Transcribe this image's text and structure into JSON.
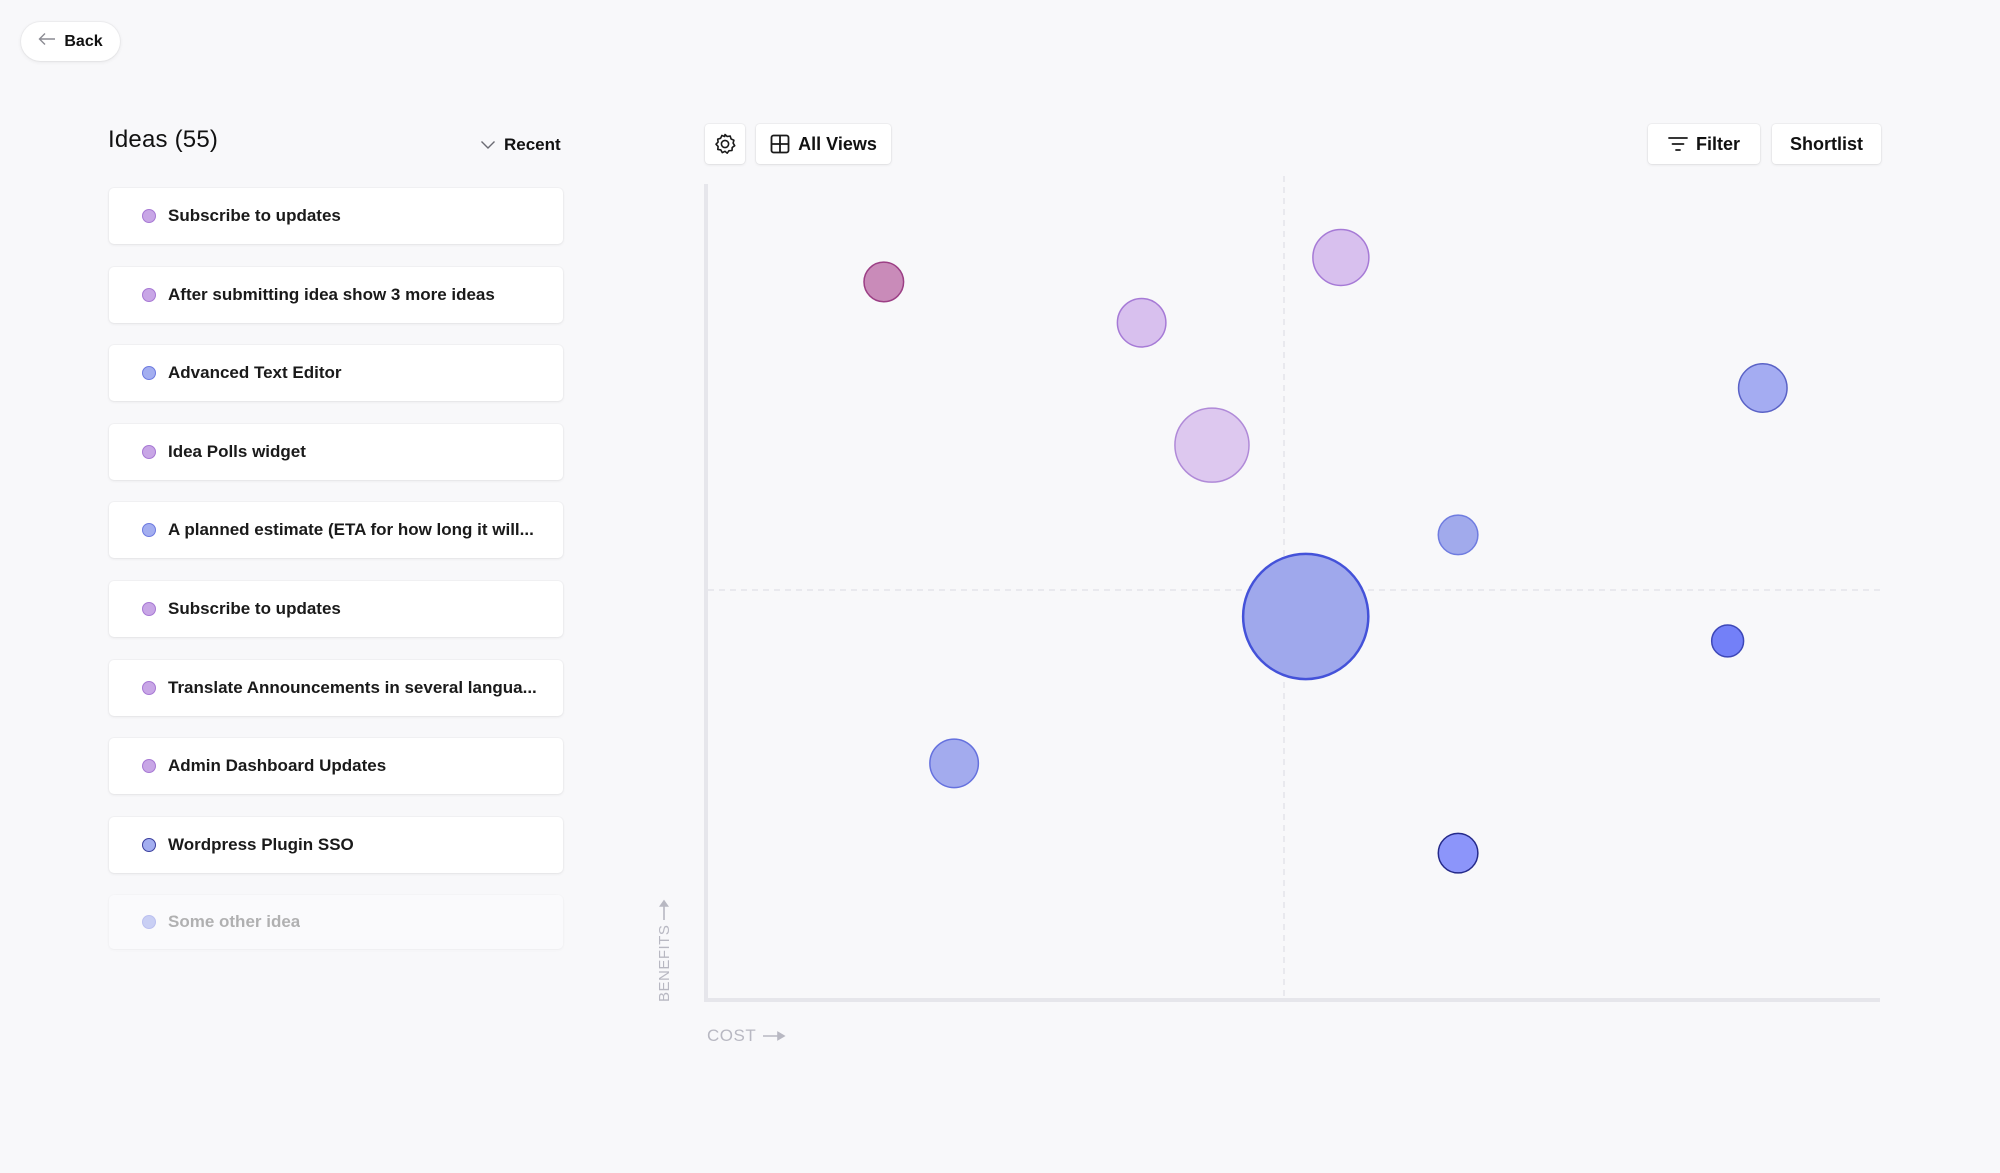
{
  "back_button": {
    "label": "Back",
    "icon": "arrow-left-icon"
  },
  "ideas_panel": {
    "title": "Ideas (55)",
    "sort": {
      "label": "Recent",
      "icon": "chevron-down-icon"
    },
    "items": [
      {
        "label": "Subscribe to updates",
        "dot_fill": "#c8a6e6",
        "dot_border": "#a778d4"
      },
      {
        "label": "After submitting idea show 3 more ideas",
        "dot_fill": "#c8a6e6",
        "dot_border": "#a778d4"
      },
      {
        "label": "Advanced Text Editor",
        "dot_fill": "#a3aef0",
        "dot_border": "#6d7ae0"
      },
      {
        "label": "Idea Polls widget",
        "dot_fill": "#c8a6e6",
        "dot_border": "#a778d4"
      },
      {
        "label": "A planned estimate (ETA for how long it will...",
        "dot_fill": "#a3aef0",
        "dot_border": "#6d7ae0"
      },
      {
        "label": "Subscribe to updates",
        "dot_fill": "#c8a6e6",
        "dot_border": "#a778d4"
      },
      {
        "label": "Translate Announcements in several langua...",
        "dot_fill": "#c8a6e6",
        "dot_border": "#a778d4"
      },
      {
        "label": "Admin Dashboard Updates",
        "dot_fill": "#c8a6e6",
        "dot_border": "#a778d4"
      },
      {
        "label": "Wordpress Plugin SSO",
        "dot_fill": "#a3aef0",
        "dot_border": "#3b3f9e"
      },
      {
        "label": "Some other idea",
        "dot_fill": "#a3aef0",
        "dot_border": "#8a93e8",
        "faded": true
      }
    ]
  },
  "toolbar": {
    "settings_icon": "gear-icon",
    "views": {
      "label": "All Views",
      "icon": "grid-icon"
    },
    "filter": {
      "label": "Filter",
      "icon": "filter-icon"
    },
    "shortlist": {
      "label": "Shortlist"
    }
  },
  "chart_data": {
    "type": "scatter",
    "subtype": "bubble-matrix",
    "xlabel": "COST",
    "ylabel": "BENEFITS",
    "xlim": [
      0,
      100
    ],
    "ylim": [
      0,
      100
    ],
    "quadrant_divider": {
      "x": 50,
      "y": 50
    },
    "grid": false,
    "points": [
      {
        "x": 15,
        "y": 88,
        "size": 2,
        "fill": "#c98bb9",
        "stroke": "#9c3f85"
      },
      {
        "x": 37,
        "y": 83,
        "size": 3,
        "fill": "#d8c0ee",
        "stroke": "#a67ad6"
      },
      {
        "x": 54,
        "y": 91,
        "size": 4,
        "fill": "#d8c0ee",
        "stroke": "#a67ad6"
      },
      {
        "x": 43,
        "y": 68,
        "size": 7,
        "fill": "#ddc8ef",
        "stroke": "#b08ad8"
      },
      {
        "x": 90,
        "y": 75,
        "size": 3,
        "fill": "#a4acf2",
        "stroke": "#5a62c6"
      },
      {
        "x": 64,
        "y": 57,
        "size": 2,
        "fill": "#a1aaec",
        "stroke": "#6f7ce0"
      },
      {
        "x": 51,
        "y": 47,
        "size": 20,
        "fill": "#9fa8ec",
        "stroke": "#4452d9"
      },
      {
        "x": 87,
        "y": 44,
        "size": 1.3,
        "fill": "#7380f8",
        "stroke": "#3d47b8"
      },
      {
        "x": 21,
        "y": 29,
        "size": 3,
        "fill": "#a3abee",
        "stroke": "#6571de"
      },
      {
        "x": 64,
        "y": 18,
        "size": 2,
        "fill": "#8c95fa",
        "stroke": "#252a8a"
      }
    ]
  }
}
